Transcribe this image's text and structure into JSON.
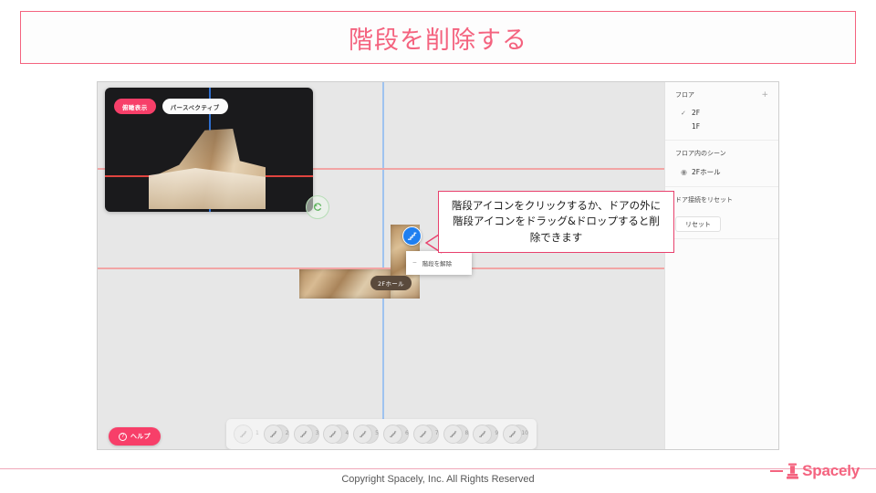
{
  "slide": {
    "title": "階段を削除する"
  },
  "app": {
    "preview3d": {
      "overhead_button": "俯瞰表示",
      "perspective_button": "パースペクティブ",
      "rotate_handle": "rotate-handle"
    },
    "plan": {
      "scene_chip_label": "2Fホール",
      "stair_icon": "stair-icon"
    },
    "context_menu": {
      "minus": "−",
      "item_label": "階段を解除"
    },
    "callout": {
      "text": "階段アイコンをクリックするか、ドアの外に階段アイコンをドラッグ&ドロップすると削除できます"
    },
    "help": {
      "icon": "?",
      "label": "ヘルプ"
    },
    "scene_bar": {
      "items": [
        {
          "number": "1"
        },
        {
          "number": "2"
        },
        {
          "number": "3"
        },
        {
          "number": "4"
        },
        {
          "number": "5"
        },
        {
          "number": "6"
        },
        {
          "number": "7"
        },
        {
          "number": "8"
        },
        {
          "number": "9"
        },
        {
          "number": "10"
        }
      ]
    },
    "sidebar": {
      "floor_section": {
        "heading": "フロア",
        "add_label": "+",
        "items": [
          {
            "check": "✓",
            "label": "2F"
          },
          {
            "check": "",
            "label": "1F"
          }
        ]
      },
      "scene_section": {
        "heading": "フロア内のシーン",
        "items": [
          {
            "label": "2Fホール"
          }
        ]
      },
      "reset_section": {
        "heading": "ドア接続をリセット",
        "button_label": "リセット"
      }
    }
  },
  "footer": {
    "copyright": "Copyright Spacely, Inc. All Rights Reserved",
    "brand": "Spacely"
  },
  "colors": {
    "accent_pink": "#f4637f",
    "button_pink": "#f73f69",
    "callout_border": "#e8416d",
    "stair_blue": "#1f7ff0",
    "guide_blue": "#9fc3ef",
    "guide_red": "#f2a5a5"
  }
}
